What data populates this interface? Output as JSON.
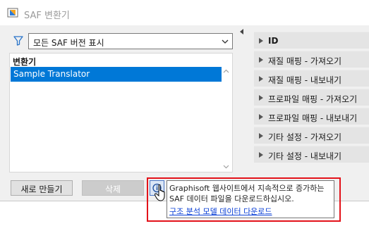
{
  "window": {
    "title": "SAF 변환기"
  },
  "filter": {
    "selected": "모든 SAF 버전 표시"
  },
  "list": {
    "header": "변환기",
    "items": [
      {
        "label": "Sample Translator",
        "selected": true
      }
    ]
  },
  "panels": [
    {
      "label": "ID"
    },
    {
      "label": "재질 매핑 - 가져오기"
    },
    {
      "label": "재질 매핑 - 내보내기"
    },
    {
      "label": "프로파일 매핑 - 가져오기"
    },
    {
      "label": "프로파일 매핑 - 내보내기"
    },
    {
      "label": "기타 설정 - 가져오기"
    },
    {
      "label": "기타 설정 - 내보내기"
    }
  ],
  "buttons": {
    "new": "새로 만들기",
    "delete": "삭제"
  },
  "tooltip": {
    "text": "Graphisoft 웹사이트에서 지속적으로 증가하는 SAF 데이터 파일을 다운로드하십시오.",
    "link": "구조 분석 모델 데이터 다운로드"
  },
  "colors": {
    "selection": "#0078d7",
    "highlight_frame": "#e3121a",
    "link": "#0a3fd6"
  }
}
